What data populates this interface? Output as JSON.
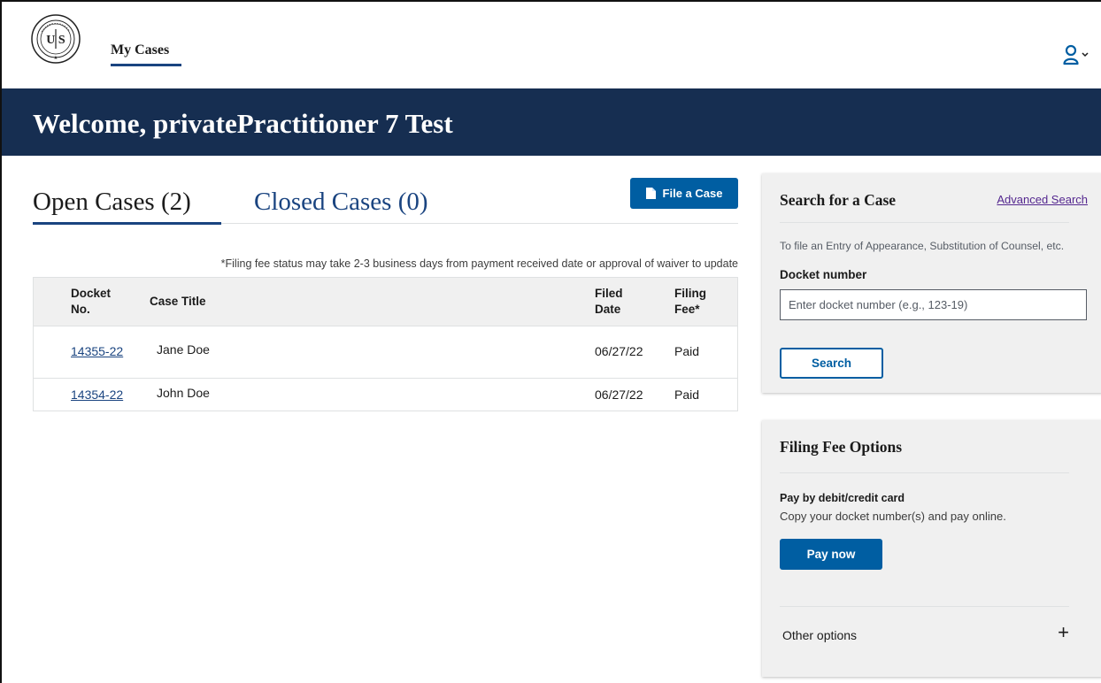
{
  "header": {
    "nav_label": "My Cases",
    "logo_icon": "us-tax-court-seal-icon",
    "account_icon": "user-account-icon"
  },
  "banner": {
    "welcome": "Welcome, privatePractitioner 7 Test"
  },
  "tabs": {
    "open": "Open Cases (2)",
    "closed": "Closed Cases (0)"
  },
  "file_case_button": "File a Case",
  "fee_note": "*Filing fee status may take 2-3 business days from payment received date or approval of waiver to update",
  "table": {
    "columns": {
      "docket_line1": "Docket",
      "docket_line2": "No.",
      "title": "Case Title",
      "filed_line1": "Filed",
      "filed_line2": "Date",
      "fee_line1": "Filing",
      "fee_line2": "Fee*"
    },
    "rows": [
      {
        "docket": "14355-22",
        "title": "Jane Doe",
        "filed": "06/27/22",
        "fee": "Paid"
      },
      {
        "docket": "14354-22",
        "title": "John Doe",
        "filed": "06/27/22",
        "fee": "Paid"
      }
    ]
  },
  "search_panel": {
    "title": "Search for a Case",
    "advanced_link": "Advanced Search",
    "hint": "To file an Entry of Appearance, Substitution of Counsel, etc.",
    "docket_label": "Docket number",
    "docket_placeholder": "Enter docket number (e.g., 123-19)",
    "search_button": "Search"
  },
  "fee_panel": {
    "title": "Filing Fee Options",
    "pay_heading": "Pay by debit/credit card",
    "pay_desc": "Copy your docket number(s) and pay online.",
    "pay_button": "Pay now",
    "other_options": "Other options"
  },
  "colors": {
    "banner": "#162e51",
    "primary": "#005ea2",
    "link": "#1a4480",
    "visited": "#54278f"
  }
}
